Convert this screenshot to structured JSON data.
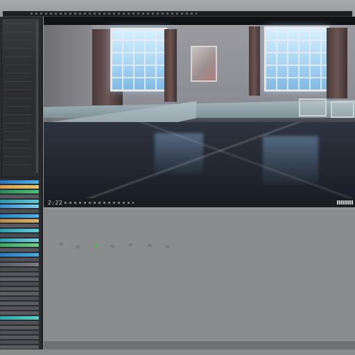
{
  "viewer": {
    "timecode": "2:22"
  },
  "colors": {
    "panel_bg": "#2b2c2f",
    "viewer_bg": "#111214",
    "timeline_bg": "#8b8c8e",
    "track_teal": "#2fb3b5",
    "track_cyan": "#3ac6e0",
    "track_orange": "#d29a4a",
    "track_green": "#45b06a",
    "track_gray": "#5a5b60"
  },
  "icons": {
    "timeline_marker": "marker-icon"
  }
}
